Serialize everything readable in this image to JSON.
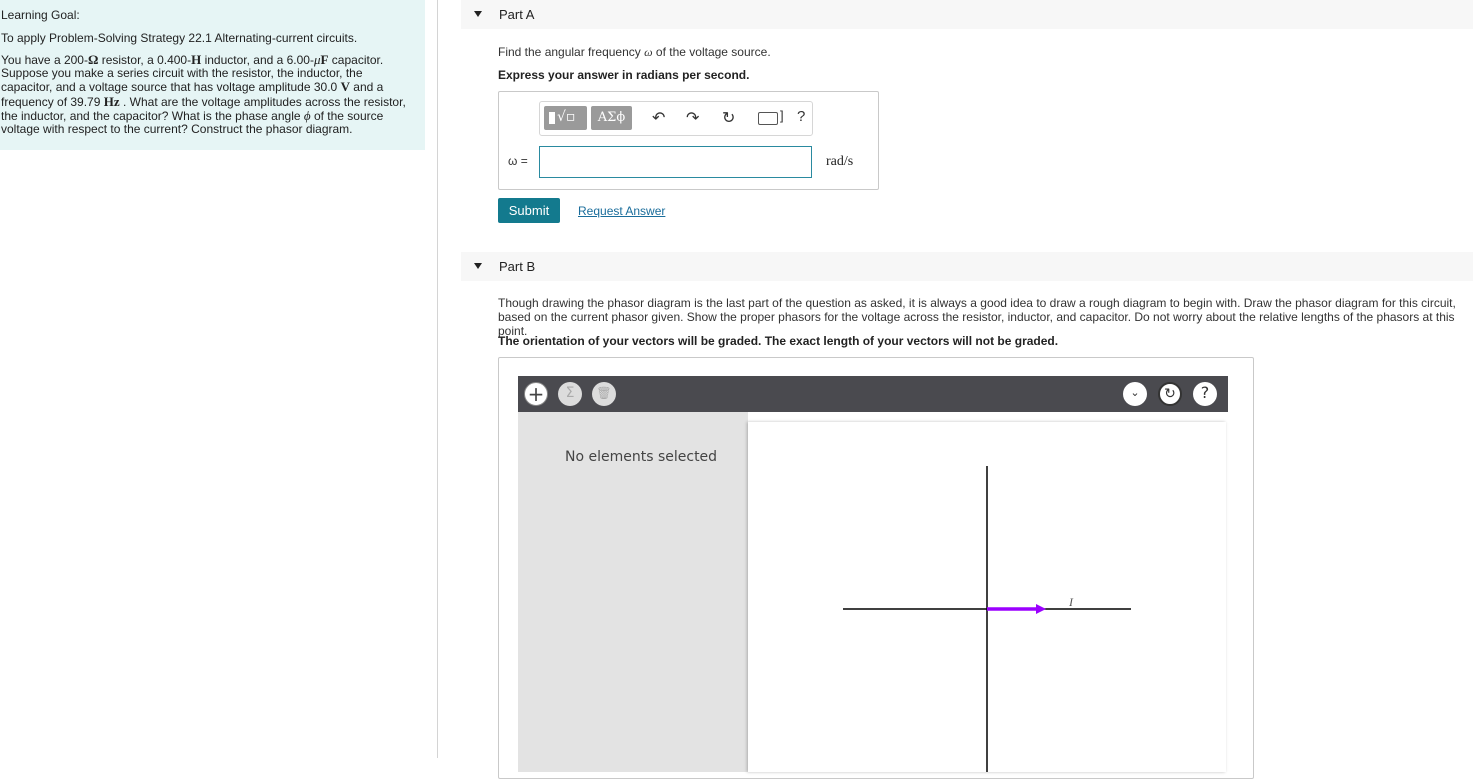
{
  "left_panel": {
    "title": "Learning Goal:",
    "intro": "To apply Problem-Solving Strategy 22.1 Alternating-current circuits.",
    "body": {
      "t1": "You have a 200-",
      "ohm": "Ω",
      "t2": " resistor, a 0.400-",
      "henry": "H",
      "t3": " inductor, and a 6.00-",
      "mu": "μ",
      "farad": "F",
      "t4": " capacitor. Suppose you make a series circuit with the resistor, the inductor, the capacitor, and a voltage source that has voltage amplitude 30.0 ",
      "volt": "V",
      "t5": " and a frequency of 39.79 ",
      "hertz": "Hz",
      "t6": " . What are the voltage amplitudes across the resistor, the inductor, and the capacitor? What is the phase angle ",
      "phi": "ϕ",
      "t7": " of the source voltage with respect to the current? Construct the phasor diagram."
    }
  },
  "part_a": {
    "label": "Part A",
    "question_pre": "Find the angular frequency ",
    "omega": "ω",
    "question_post": " of the voltage source.",
    "instruction": "Express your answer in radians per second.",
    "toolbar": {
      "greek": "ΑΣϕ",
      "sqrt": "√▫",
      "undo": "↶",
      "redo": "↷",
      "reset": "↻",
      "keyboard_bracket": "]",
      "help": "?"
    },
    "variable_label": "ω =",
    "input_value": "",
    "unit": "rad/s",
    "submit_label": "Submit",
    "request_label": "Request Answer"
  },
  "part_b": {
    "label": "Part B",
    "question": "Though drawing the phasor diagram is the last part of the question as asked, it is always a good idea to draw a rough diagram to begin with. Draw the phasor diagram for this circuit, based on the current phasor given. Show the proper phasors for the voltage across the resistor, inductor, and capacitor. Do not worry about the relative lengths of the phasors at this point.",
    "instruction": "The orientation of your vectors will be graded. The exact length of your vectors will not be graded.",
    "tool": {
      "add": "+",
      "sigma": "Σ",
      "delete": "🗑",
      "dropdown": "⌄",
      "reset": "↻",
      "help": "?",
      "status": "No elements selected",
      "current_label": "I",
      "current_color": "#9b00ff"
    }
  },
  "colors": {
    "left_panel_bg": "#e6f5f5",
    "submit_bg": "#137a8e",
    "link": "#1a6d9b",
    "tool_bar_bg": "#4a4a4f",
    "phasor": "#9b00ff"
  }
}
